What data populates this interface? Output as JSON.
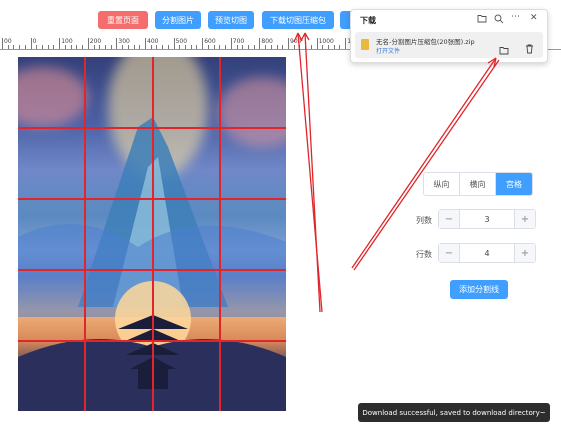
{
  "toolbar": {
    "reset_label": "重置页面",
    "split_label": "分割图片",
    "preview_label": "预览切图",
    "download_label": "下载切图压缩包"
  },
  "ruler": {
    "labels": [
      "00",
      "0",
      "100",
      "200",
      "300",
      "400",
      "500",
      "600",
      "700",
      "800",
      "900",
      "1000",
      "1100"
    ]
  },
  "split_mode": {
    "options": [
      "纵向",
      "横向",
      "宫格"
    ],
    "selected": "宫格"
  },
  "columns": {
    "label": "列数",
    "value": "3",
    "minus": "−",
    "plus": "+"
  },
  "rows": {
    "label": "行数",
    "value": "4",
    "minus": "−",
    "plus": "+"
  },
  "add_button_label": "添加分割线",
  "download_panel": {
    "title": "下载",
    "file_name": "无名-分割图片压缩包(20张图).zip",
    "open_file_label": "打开文件",
    "icons": [
      "folder-icon",
      "search-icon",
      "more-icon",
      "close-icon"
    ]
  },
  "toast": "Download successful, saved to download directory~",
  "colors": {
    "primary": "#409eff",
    "danger": "#f56c6c",
    "grid_line": "#e0262a",
    "arrow": "#e0262a"
  }
}
